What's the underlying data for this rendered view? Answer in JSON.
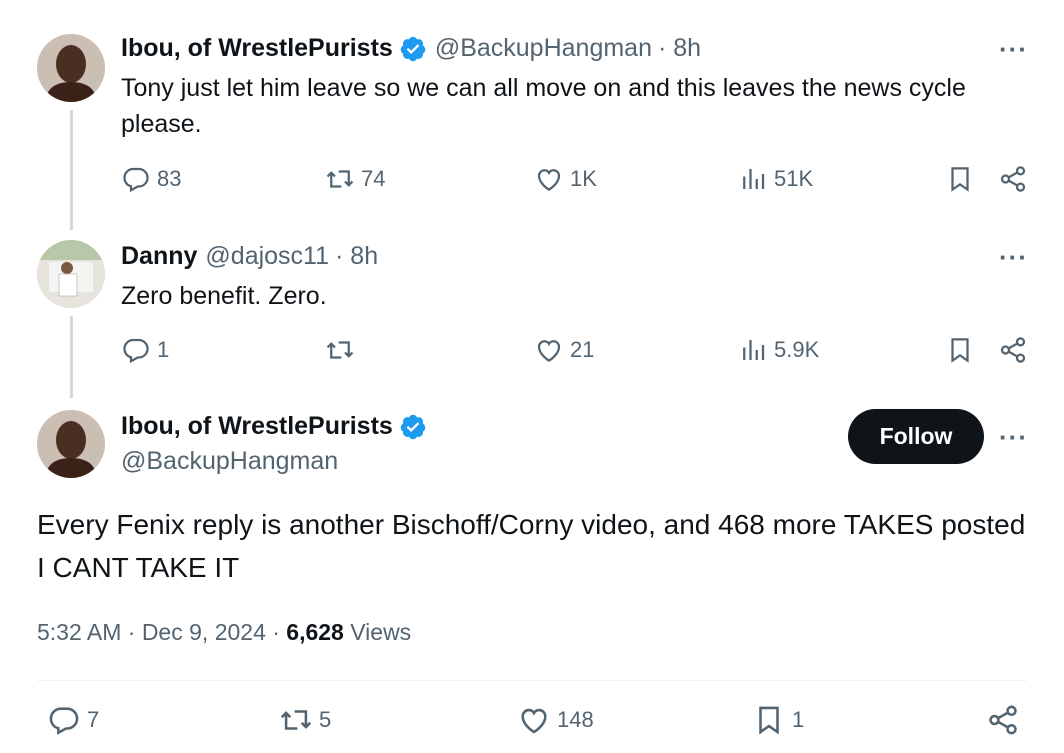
{
  "tweets": [
    {
      "name": "Ibou, of WrestlePurists",
      "handle": "@BackupHangman",
      "time": "· 8h",
      "text": "Tony just let him leave so we can all move on and this leaves the news cycle please.",
      "replies": "83",
      "retweets": "74",
      "likes": "1K",
      "views": "51K"
    },
    {
      "name": "Danny",
      "handle": "@dajosc11",
      "time": "· 8h",
      "text": "Zero benefit. Zero.",
      "replies": "1",
      "retweets": "",
      "likes": "21",
      "views": "5.9K"
    }
  ],
  "main_tweet": {
    "name": "Ibou, of WrestlePurists",
    "handle": "@BackupHangman",
    "follow_label": "Follow",
    "text": "Every Fenix reply is another Bischoff/Corny video, and 468 more TAKES posted I CANT TAKE IT",
    "timestamp": "5:32 AM · Dec 9, 2024 · ",
    "views_count": "6,628",
    "views_label": " Views",
    "replies": "7",
    "retweets": "5",
    "likes": "148",
    "bookmarks": "1"
  },
  "more_label": "···",
  "colors": {
    "verified": "#1d9bf0",
    "text": "#0f1419",
    "muted": "#536471"
  },
  "icons": [
    "reply-icon",
    "retweet-icon",
    "like-icon",
    "views-icon",
    "bookmark-icon",
    "share-icon",
    "verified-badge-icon"
  ]
}
